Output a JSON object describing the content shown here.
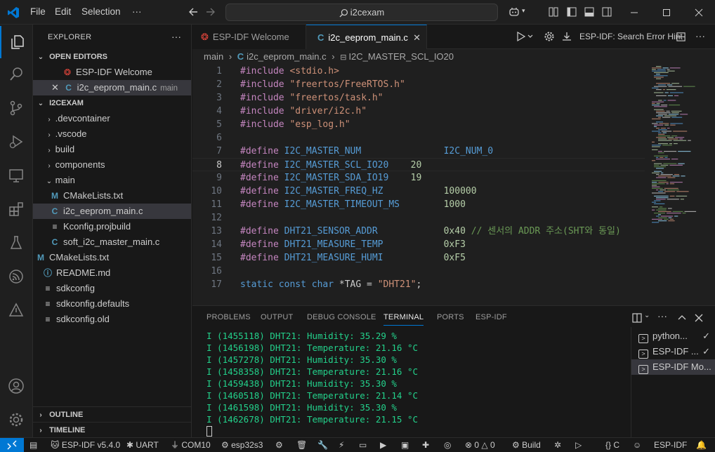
{
  "titlebar": {
    "menu": [
      "File",
      "Edit",
      "Selection",
      "···"
    ],
    "search_text": "i2cexam"
  },
  "explorer": {
    "title": "EXPLORER",
    "more": "···",
    "open_editors_label": "OPEN EDITORS",
    "open_editors": [
      {
        "name": "ESP-IDF Welcome",
        "hint": ""
      },
      {
        "name": "i2c_eeprom_main.c",
        "hint": "main"
      }
    ],
    "folder_label": "I2CEXAM",
    "tree": [
      {
        "name": ".devcontainer",
        "kind": "folder",
        "depth": 1
      },
      {
        "name": ".vscode",
        "kind": "folder",
        "depth": 1
      },
      {
        "name": "build",
        "kind": "folder",
        "depth": 1
      },
      {
        "name": "components",
        "kind": "folder",
        "depth": 1
      },
      {
        "name": "main",
        "kind": "folder-open",
        "depth": 1
      },
      {
        "name": "CMakeLists.txt",
        "kind": "cmake",
        "depth": 2
      },
      {
        "name": "i2c_eeprom_main.c",
        "kind": "c",
        "depth": 2
      },
      {
        "name": "Kconfig.projbuild",
        "kind": "text",
        "depth": 2
      },
      {
        "name": "soft_i2c_master_main.c",
        "kind": "c",
        "depth": 2
      },
      {
        "name": "CMakeLists.txt",
        "kind": "cmake",
        "depth": 1
      },
      {
        "name": "README.md",
        "kind": "info",
        "depth": 1
      },
      {
        "name": "sdkconfig",
        "kind": "text",
        "depth": 1
      },
      {
        "name": "sdkconfig.defaults",
        "kind": "text",
        "depth": 1
      },
      {
        "name": "sdkconfig.old",
        "kind": "text",
        "depth": 1
      }
    ],
    "outline_label": "OUTLINE",
    "timeline_label": "TIMELINE"
  },
  "editor": {
    "tabs": [
      {
        "label": "ESP-IDF Welcome",
        "active": false
      },
      {
        "label": "i2c_eeprom_main.c",
        "active": true
      }
    ],
    "hint_label": "ESP-IDF: Search Error Hint",
    "breadcrumb": [
      "main",
      "i2c_eeprom_main.c",
      "I2C_MASTER_SCL_IO20"
    ],
    "current_line": 8,
    "lines": [
      {
        "n": "1",
        "t": [
          [
            "pp",
            "#include "
          ],
          [
            "str",
            "<stdio.h>"
          ]
        ]
      },
      {
        "n": "2",
        "t": [
          [
            "pp",
            "#include "
          ],
          [
            "str",
            "\"freertos/FreeRTOS.h\""
          ]
        ]
      },
      {
        "n": "3",
        "t": [
          [
            "pp",
            "#include "
          ],
          [
            "str",
            "\"freertos/task.h\""
          ]
        ]
      },
      {
        "n": "4",
        "t": [
          [
            "pp",
            "#include "
          ],
          [
            "str",
            "\"driver/i2c.h\""
          ]
        ]
      },
      {
        "n": "5",
        "t": [
          [
            "pp",
            "#include "
          ],
          [
            "str",
            "\"esp_log.h\""
          ]
        ]
      },
      {
        "n": "6",
        "t": []
      },
      {
        "n": "7",
        "t": [
          [
            "pp",
            "#define "
          ],
          [
            "mac",
            "I2C_MASTER_NUM               "
          ],
          [
            "mac",
            "I2C_NUM_0"
          ]
        ]
      },
      {
        "n": "8",
        "t": [
          [
            "pp",
            "#define "
          ],
          [
            "mac",
            "I2C_MASTER_SCL_IO20"
          ],
          [
            "num",
            "    20"
          ]
        ]
      },
      {
        "n": "9",
        "t": [
          [
            "pp",
            "#define "
          ],
          [
            "mac",
            "I2C_MASTER_SDA_IO19"
          ],
          [
            "num",
            "    19"
          ]
        ]
      },
      {
        "n": "10",
        "t": [
          [
            "pp",
            "#define "
          ],
          [
            "mac",
            "I2C_MASTER_FREQ_HZ           "
          ],
          [
            "num",
            "100000"
          ]
        ]
      },
      {
        "n": "11",
        "t": [
          [
            "pp",
            "#define "
          ],
          [
            "mac",
            "I2C_MASTER_TIMEOUT_MS        "
          ],
          [
            "num",
            "1000"
          ]
        ]
      },
      {
        "n": "12",
        "t": []
      },
      {
        "n": "13",
        "t": [
          [
            "pp",
            "#define "
          ],
          [
            "mac",
            "DHT21_SENSOR_ADDR            "
          ],
          [
            "num",
            "0x40"
          ],
          [
            "cmt",
            " // 센서의 ADDR 주소(SHT와 동일)"
          ]
        ]
      },
      {
        "n": "14",
        "t": [
          [
            "pp",
            "#define "
          ],
          [
            "mac",
            "DHT21_MEASURE_TEMP           "
          ],
          [
            "num",
            "0xF3"
          ]
        ]
      },
      {
        "n": "15",
        "t": [
          [
            "pp",
            "#define "
          ],
          [
            "mac",
            "DHT21_MEASURE_HUMI           "
          ],
          [
            "num",
            "0xF5"
          ]
        ]
      },
      {
        "n": "16",
        "t": []
      },
      {
        "n": "17",
        "t": [
          [
            "ty",
            "static const char "
          ],
          [
            "plain",
            "*TAG = "
          ],
          [
            "str",
            "\"DHT21\""
          ],
          [
            "plain",
            ";"
          ]
        ]
      }
    ]
  },
  "panel": {
    "tabs": [
      "PROBLEMS",
      "OUTPUT",
      "DEBUG CONSOLE",
      "TERMINAL",
      "PORTS",
      "ESP-IDF"
    ],
    "active_tab": "TERMINAL",
    "terminal_lines": [
      "I (1455118) DHT21: Humidity: 35.29 %",
      "I (1456198) DHT21: Temperature: 21.16 °C",
      "I (1457278) DHT21: Humidity: 35.30 %",
      "I (1458358) DHT21: Temperature: 21.16 °C",
      "I (1459438) DHT21: Humidity: 35.30 %",
      "I (1460518) DHT21: Temperature: 21.14 °C",
      "I (1461598) DHT21: Humidity: 35.30 %",
      "I (1462678) DHT21: Temperature: 21.15 °C"
    ],
    "terminals": [
      {
        "label": "python...",
        "check": true
      },
      {
        "label": "ESP-IDF ...",
        "check": true
      },
      {
        "label": "ESP-IDF Mo...",
        "check": false
      }
    ]
  },
  "statusbar": {
    "idf": "ESP-IDF v5.4.0",
    "uart": "UART",
    "port": "COM10",
    "target": "esp32s3",
    "errors": "0",
    "warnings": "0",
    "build": "Build",
    "lang": "C",
    "right_label": "ESP-IDF"
  },
  "colors": {
    "accent": "#0078d4",
    "terminal_green": "#23d18b"
  }
}
